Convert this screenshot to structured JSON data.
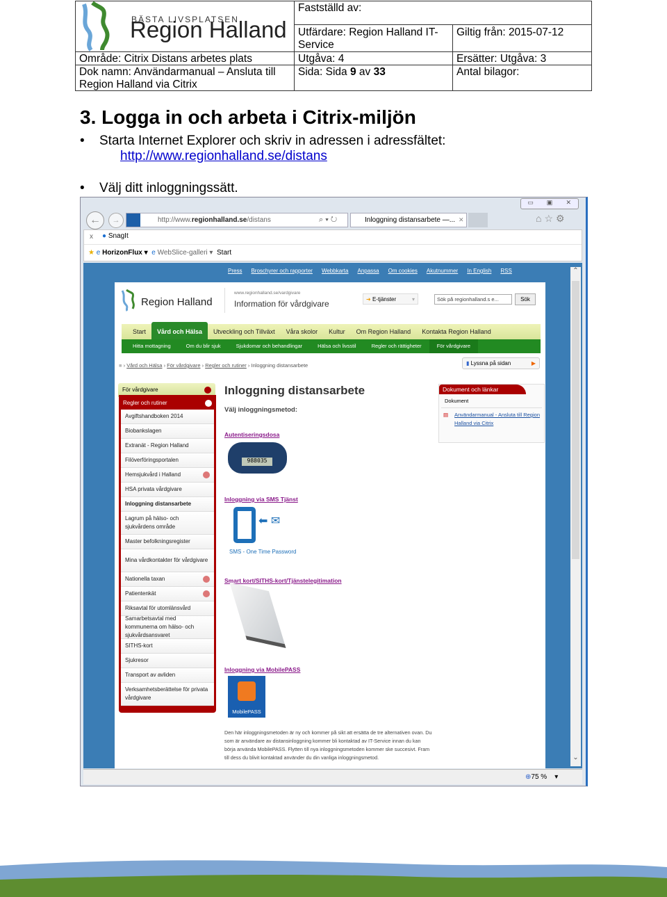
{
  "header": {
    "logo_tagline": "BÄSTA LIVSPLATSEN",
    "logo_name": "Region Halland",
    "faststalld": "Fastställd av:",
    "utfardare": "Utfärdare: Region Halland IT-Service",
    "giltig": "Giltig från: 2015-07-12",
    "omrade": "Område: Citrix Distans arbetes plats",
    "utgava": "Utgåva: 4",
    "ersatter": "Ersätter: Utgåva: 3",
    "doknamn": "Dok namn: Användarmanual – Ansluta till Region Halland via Citrix",
    "sida_label": "Sida: Sida ",
    "sida_num": "9",
    "sida_av": " av ",
    "sida_total": "33",
    "bilagor": "Antal bilagor:"
  },
  "section": {
    "title": "3. Logga in och arbeta i Citrix-miljön",
    "bullet1": "Starta Internet Explorer och skriv in adressen i adressfältet:",
    "bullet1_link": "http://www.regionhalland.se/distans",
    "bullet2": "Välj ditt inloggningssätt."
  },
  "browser": {
    "url_prefix": "http://www.",
    "url_domain": "regionhalland.se",
    "url_path": "/distans",
    "tab_title": "Inloggning distansarbete —...",
    "toolbar": {
      "close": "x",
      "snagit": "SnagIt"
    },
    "favorites": [
      "HorizonFlux ▾",
      "WebSlice-galleri ▾",
      "Start"
    ],
    "zoom": "75 %"
  },
  "site": {
    "toplinks": [
      "Press",
      "Broschyrer och rapporter",
      "Webbkarta",
      "Anpassa",
      "Om cookies",
      "Akutnummer",
      "In English",
      "RSS"
    ],
    "logo": "Region Halland",
    "subtitle_small": "www.regionhalland.se/vardgivare",
    "subtitle": "Information för vårdgivare",
    "etjanster": "E-tjänster",
    "search_placeholder": "Sök på regionhalland.s e...",
    "search_button": "Sök",
    "nav": [
      "Start",
      "Vård och Hälsa",
      "Utveckling och Tillväxt",
      "Våra skolor",
      "Kultur",
      "Om Region Halland",
      "Kontakta Region Halland"
    ],
    "nav_active": 1,
    "subnav": [
      "Hitta mottagning",
      "Om du blir sjuk",
      "Sjukdomar och behandlingar",
      "Hälsa och livsstil",
      "Regler och rättigheter",
      "För vårdgivare"
    ],
    "breadcrumb": [
      "Vård och Hälsa",
      "För vårdgivare",
      "Regler och rutiner",
      "Inloggning distansarbete"
    ],
    "listen": "Lyssna på sidan",
    "sidebar_parent": "För vårdgivare",
    "sidebar_section": "Regler och rutiner",
    "sidebar_items": [
      {
        "label": "Avgiftshandboken 2014",
        "arrow": false
      },
      {
        "label": "Biobankslagen",
        "arrow": false
      },
      {
        "label": "Extranät - Region Halland",
        "arrow": false
      },
      {
        "label": "Filöverföringsportalen",
        "arrow": false
      },
      {
        "label": "Hemsjukvård i Halland",
        "arrow": true
      },
      {
        "label": "HSA privata vårdgivare",
        "arrow": false
      },
      {
        "label": "Inloggning distansarbete",
        "arrow": false,
        "active": true
      },
      {
        "label": "Lagrum på hälso- och sjukvårdens område",
        "arrow": false
      },
      {
        "label": "Master befolkningsregister",
        "arrow": false
      },
      {
        "label": "Mina vårdkontakter för vårdgivare",
        "arrow": false
      },
      {
        "label": "Nationella taxan",
        "arrow": true
      },
      {
        "label": "Patientenkät",
        "arrow": true
      },
      {
        "label": "Riksavtal för utomlänsvård",
        "arrow": false
      },
      {
        "label": "Samarbetsavtal med kommunerna om hälso- och sjukvårdsansvaret",
        "arrow": false
      },
      {
        "label": "SITHS-kort",
        "arrow": false
      },
      {
        "label": "Sjukresor",
        "arrow": false
      },
      {
        "label": "Transport av avliden",
        "arrow": false
      },
      {
        "label": "Verksamhetsberättelse för privata vårdgivare",
        "arrow": false
      }
    ],
    "main_title": "Inloggning distansarbete",
    "main_sub": "Välj inloggningsmetod:",
    "methods": {
      "token": "Autentiseringsdosa",
      "token_display": "988035",
      "sms": "Inloggning via SMS Tjänst",
      "sms_caption": "SMS - One Time Password",
      "smartcard": "Smart kort/SITHS-kort/Tjänstelegitimation",
      "mobilepass": "Inloggning via MobilePASS",
      "mobilepass_caption": "MobilePASS"
    },
    "info_text": "Den här inloggningsmetoden är ny och kommer på sikt att ersätta de tre alternativen ovan. Du som är användare av distansinloggning kommer bli kontaktad av IT-Service innan du kan börja använda MobilePASS. Flytten till nya inloggningsmetoden kommer ske succesivt. Fram till dess du blivit kontaktad använder du din vanliga inloggningsmetod.",
    "docs_title": "Dokument och länkar",
    "docs_sub": "Dokument",
    "docs_link": "Användarmanual - Ansluta till Region Halland via Citrix"
  },
  "colors": {
    "site_blue": "#3b7db5",
    "nav_green": "#2a8a2a",
    "sidebar_red": "#a00000",
    "link_purple": "#8a1a8a"
  }
}
